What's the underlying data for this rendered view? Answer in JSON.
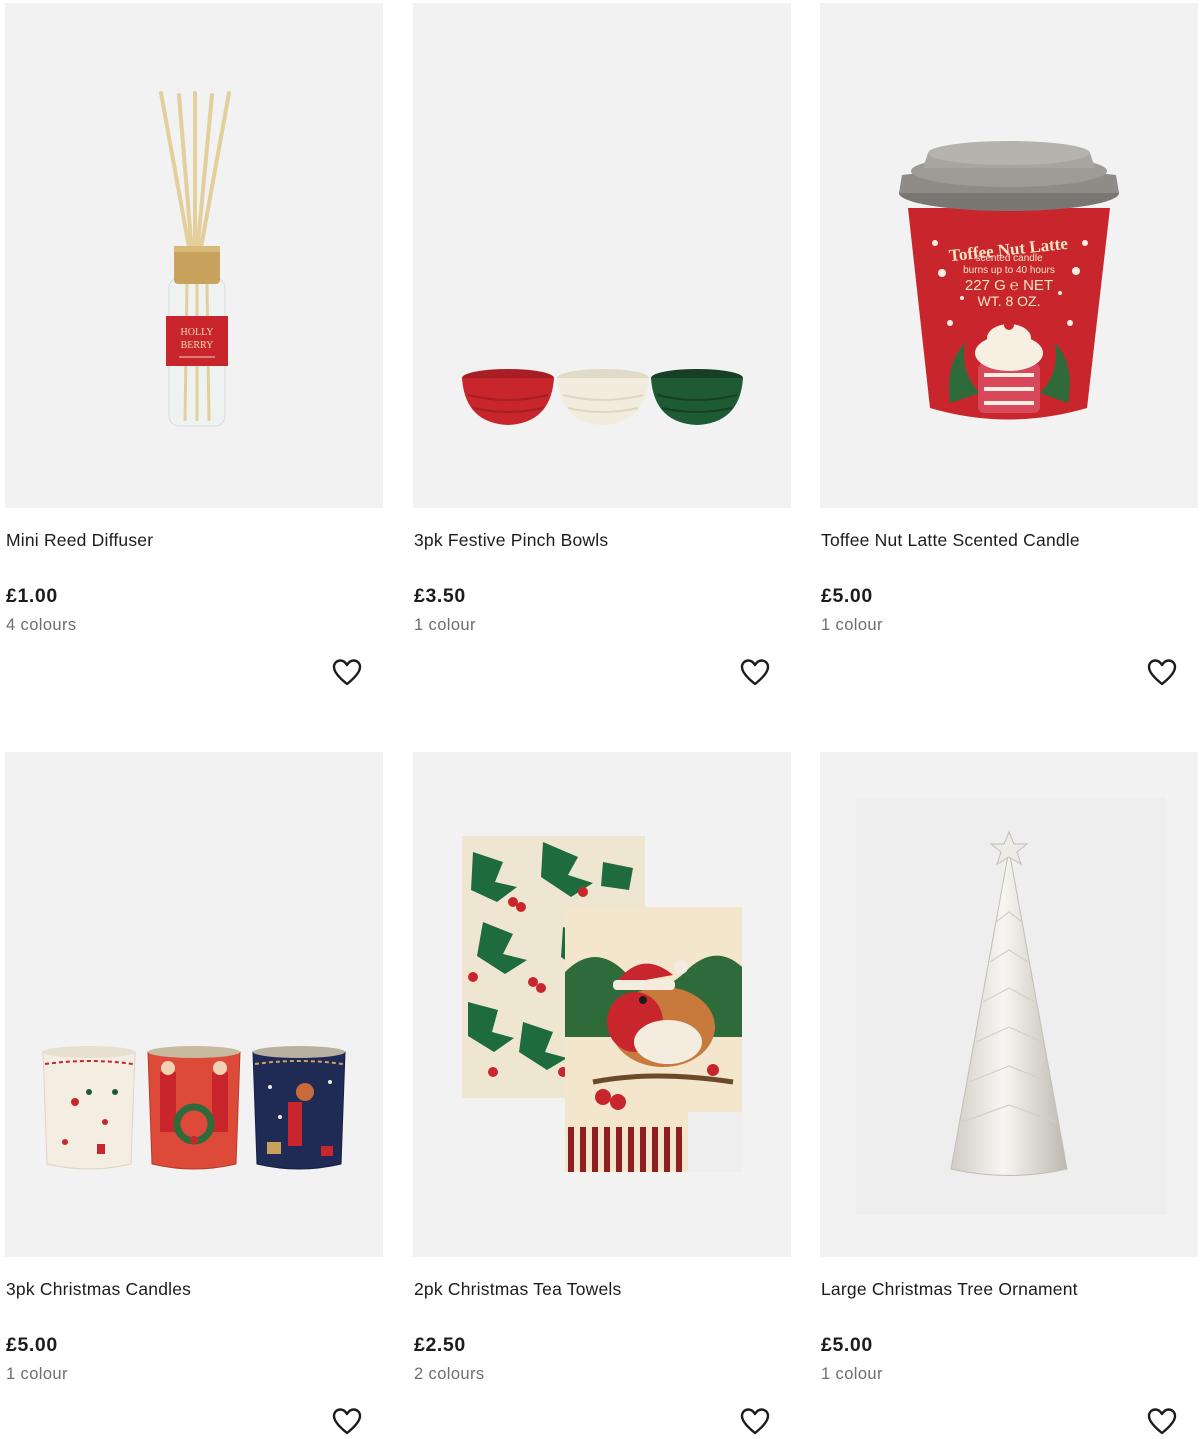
{
  "products": [
    {
      "name": "Mini Reed Diffuser",
      "price": "£1.00",
      "colours": "4 colours",
      "image_icon": "reed-diffuser-image",
      "label_text": [
        "HOLLY",
        "BERRY"
      ]
    },
    {
      "name": "3pk Festive Pinch Bowls",
      "price": "£3.50",
      "colours": "1 colour",
      "image_icon": "pinch-bowls-image"
    },
    {
      "name": "Toffee Nut Latte Scented Candle",
      "price": "£5.00",
      "colours": "1 colour",
      "image_icon": "latte-candle-image",
      "label_text": [
        "Toffee Nut Latte",
        "scented candle",
        "burns up to 40 hours",
        "227 G ℮ NET",
        "WT. 8 OZ."
      ]
    },
    {
      "name": "3pk Christmas Candles",
      "price": "£5.00",
      "colours": "1 colour",
      "image_icon": "christmas-candles-image"
    },
    {
      "name": "2pk Christmas Tea Towels",
      "price": "£2.50",
      "colours": "2 colours",
      "image_icon": "tea-towels-image"
    },
    {
      "name": "Large Christmas Tree Ornament",
      "price": "£5.00",
      "colours": "1 colour",
      "image_icon": "tree-ornament-image"
    }
  ],
  "wishlist_icon": "heart-outline-icon",
  "colors": {
    "card_bg": "#f2f2f2",
    "text": "#1c1c1c",
    "muted": "#6e6e6e",
    "festive_red": "#c8262c",
    "festive_green": "#1e5a34"
  }
}
